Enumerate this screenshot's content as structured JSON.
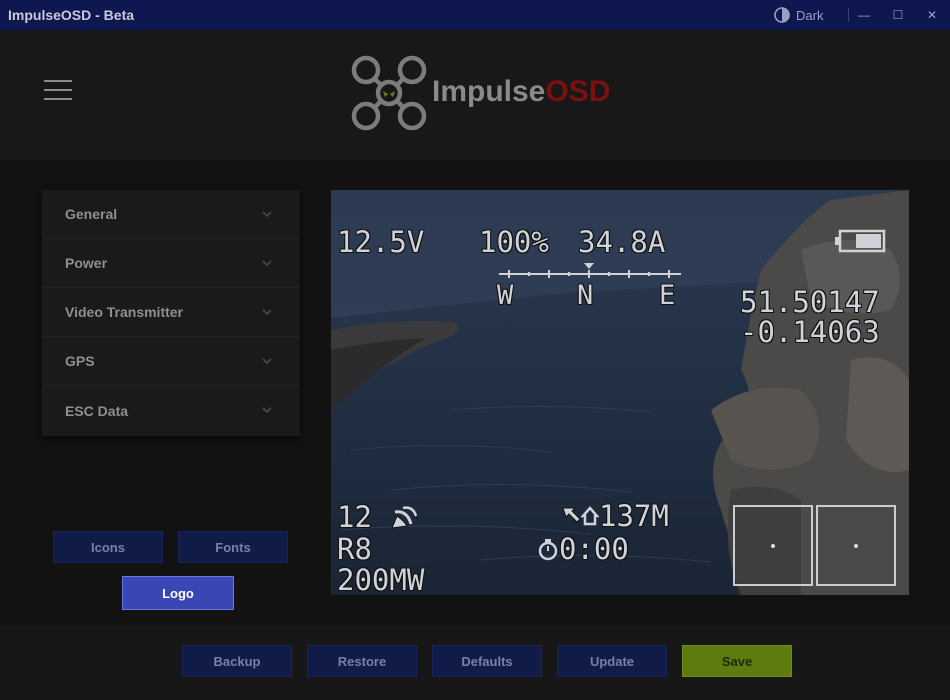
{
  "window": {
    "title": "ImpulseOSD - Beta",
    "theme_label": "Dark",
    "minimize": "—",
    "maximize": "☐",
    "close": "✕"
  },
  "header": {
    "logo_part1": "Impulse",
    "logo_part2": "OSD",
    "logo_color_grey": "#8a8a8a",
    "logo_color_red": "#7a1010"
  },
  "sidebar": {
    "items": [
      {
        "label": "General",
        "icon": "chevron-down-icon"
      },
      {
        "label": "Power",
        "icon": "chevron-down-icon"
      },
      {
        "label": "Video Transmitter",
        "icon": "chevron-down-icon"
      },
      {
        "label": "GPS",
        "icon": "chevron-down-icon"
      },
      {
        "label": "ESC Data",
        "icon": "chevron-down-icon"
      }
    ],
    "icons_button": "Icons",
    "fonts_button": "Fonts",
    "logo_button": "Logo"
  },
  "osd": {
    "voltage": "12.5V",
    "throttle": "100%",
    "current": "34.8A",
    "compass_w": "W",
    "compass_n": "N",
    "compass_e": "E",
    "latitude": "51.50147",
    "longitude": "-0.14063",
    "sats": "12",
    "rssi": "R8",
    "power": "200MW",
    "distance": "137M",
    "timer": "0:00"
  },
  "footer": {
    "backup": "Backup",
    "restore": "Restore",
    "defaults": "Defaults",
    "update": "Update",
    "save": "Save"
  },
  "colors": {
    "titlebar": "#0f1750",
    "button": "#111b48",
    "logo_button": "#3a46b5",
    "save_button": "#5c7c10"
  }
}
